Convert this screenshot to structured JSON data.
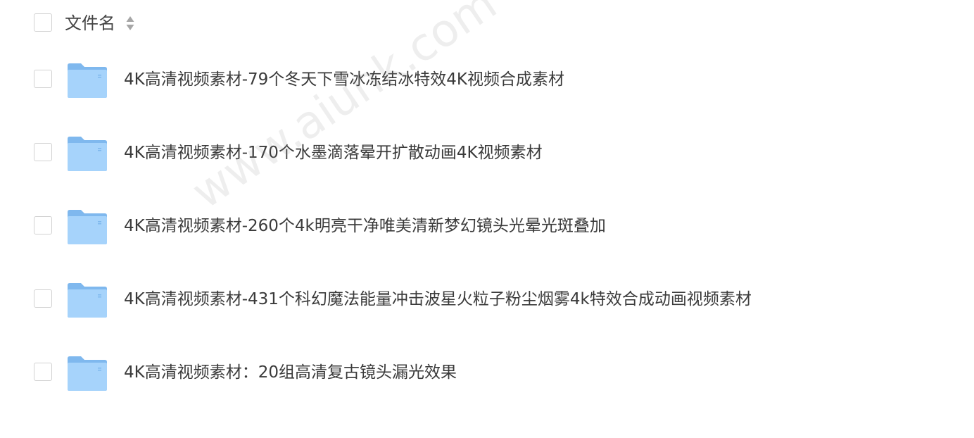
{
  "header": {
    "column_label": "文件名",
    "sort_icon": "sort-up-down-icon"
  },
  "watermark": "www.aiunk.com",
  "files": [
    {
      "name": "4K高清视频素材-79个冬天下雪冰冻结冰特效4K视频合成素材",
      "icon": "folder-icon"
    },
    {
      "name": "4K高清视频素材-170个水墨滴落晕开扩散动画4K视频素材",
      "icon": "folder-icon"
    },
    {
      "name": "4K高清视频素材-260个4k明亮干净唯美清新梦幻镜头光晕光斑叠加",
      "icon": "folder-icon"
    },
    {
      "name": "4K高清视频素材-431个科幻魔法能量冲击波星火粒子粉尘烟雾4k特效合成动画视频素材",
      "icon": "folder-icon"
    },
    {
      "name": "4K高清视频素材：20组高清复古镜头漏光效果",
      "icon": "folder-icon"
    }
  ],
  "colors": {
    "folder_back": "#7fb8ee",
    "folder_front": "#a6d3fb",
    "checkbox_border": "#d2d2d2",
    "text": "#3a3a3a"
  }
}
